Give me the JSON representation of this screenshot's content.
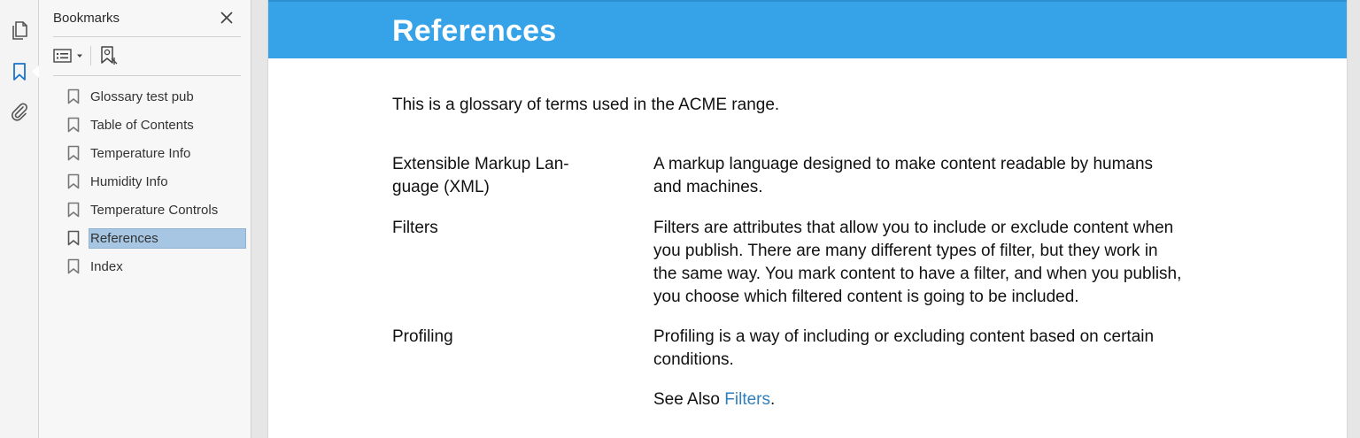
{
  "sidebar_tools": [
    {
      "name": "pages-icon",
      "active": false
    },
    {
      "name": "bookmark-icon",
      "active": true
    },
    {
      "name": "paperclip-icon",
      "active": false
    }
  ],
  "bookmarks_panel": {
    "title": "Bookmarks",
    "items": [
      {
        "label": "Glossary test pub",
        "selected": false
      },
      {
        "label": "Table of Contents",
        "selected": false
      },
      {
        "label": "Temperature Info",
        "selected": false
      },
      {
        "label": "Humidity Info",
        "selected": false
      },
      {
        "label": "Temperature Controls",
        "selected": false
      },
      {
        "label": "References",
        "selected": true
      },
      {
        "label": "Index",
        "selected": false
      }
    ]
  },
  "document": {
    "heading": "References",
    "intro": "This is a glossary of terms used in the ACME range.",
    "glossary": [
      {
        "term_line1": "Extensible Markup Lan-",
        "term_line2": "guage (XML)",
        "definition_line1": "A markup language designed to make content readable by humans",
        "definition_line2": "and machines."
      },
      {
        "term": "Filters",
        "definition_lines": [
          "Filters are attributes that allow you to include or exclude content when",
          "you publish. There are many different types of filter, but they work in",
          "the same way. You mark content to have a filter, and when you publish,",
          "you choose which filtered content is going to be included."
        ]
      },
      {
        "term": "Profiling",
        "definition_lines": [
          "Profiling is a way of including or excluding content based on certain",
          "conditions."
        ],
        "see_also_prefix": "See Also ",
        "see_also_link": "Filters",
        "see_also_suffix": "."
      }
    ]
  },
  "colors": {
    "header_blue": "#36a2e8",
    "link_blue": "#2f7fbd",
    "selection": "#a6c6e3",
    "active_tool": "#1a73c9"
  }
}
